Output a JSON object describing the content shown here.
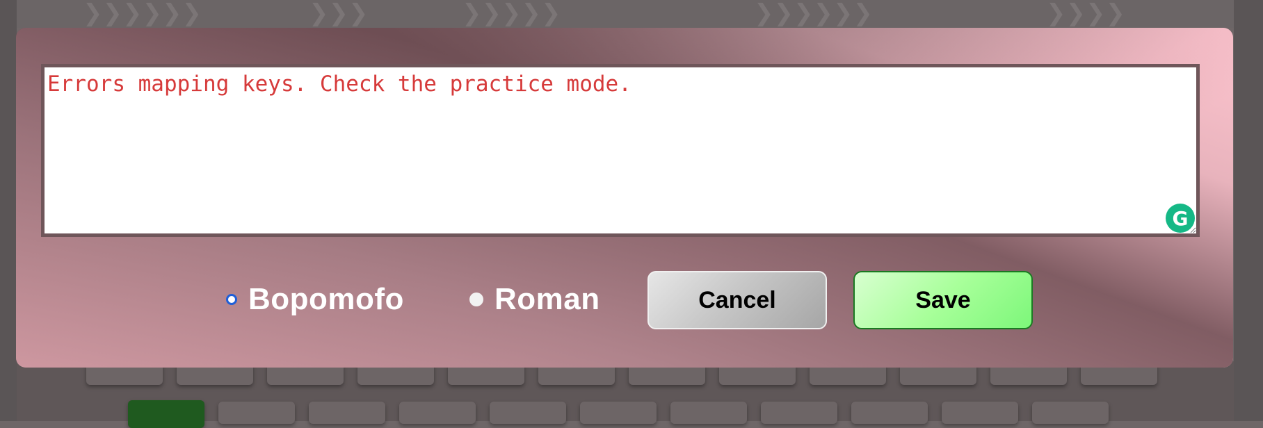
{
  "dialog": {
    "message": "Errors mapping keys. Check the practice mode.",
    "grammarly_icon": "G",
    "mode_options": [
      {
        "label": "Bopomofo",
        "selected": true
      },
      {
        "label": "Roman",
        "selected": false
      }
    ],
    "cancel_label": "Cancel",
    "save_label": "Save"
  },
  "colors": {
    "message_text": "#d63a3a",
    "save_button": "#a8ff9a",
    "cancel_button": "#c7c7c7",
    "radio_selected": "#1e5fd8",
    "grammarly": "#15b886"
  }
}
